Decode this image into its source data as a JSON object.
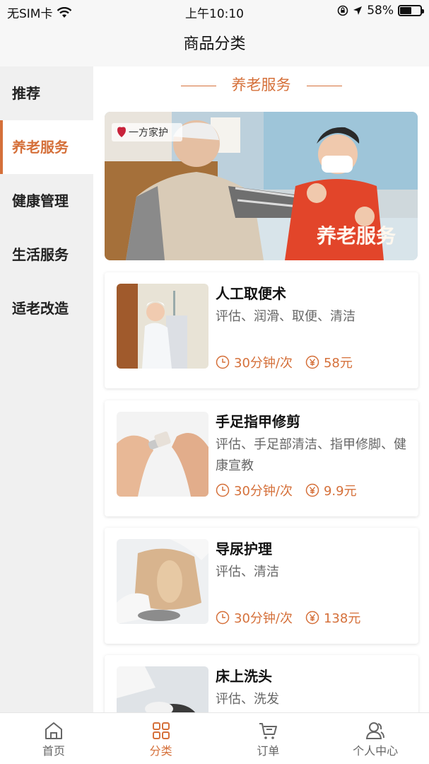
{
  "status_bar": {
    "carrier": "无SIM卡",
    "time": "上午10:10",
    "battery": "58%",
    "battery_level": 0.58
  },
  "header": {
    "title": "商品分类"
  },
  "sidebar": {
    "items": [
      {
        "label": "推荐"
      },
      {
        "label": "养老服务"
      },
      {
        "label": "健康管理"
      },
      {
        "label": "生活服务"
      },
      {
        "label": "适老改造"
      }
    ],
    "active_index": 1
  },
  "main": {
    "section_title": "养老服务",
    "banner": {
      "logo_text": "一方家护",
      "overlay_text": "养老服务"
    },
    "services": [
      {
        "name": "人工取便术",
        "desc": "评估、润滑、取便、清洁",
        "duration": "30分钟/次",
        "price": "58元"
      },
      {
        "name": "手足指甲修剪",
        "desc": "评估、手足部清洁、指甲修脚、健康宣教",
        "duration": "30分钟/次",
        "price": "9.9元"
      },
      {
        "name": "导尿护理",
        "desc": "评估、清洁",
        "duration": "30分钟/次",
        "price": "138元"
      },
      {
        "name": "床上洗头",
        "desc": "评估、洗发",
        "duration": "",
        "price": ""
      }
    ]
  },
  "tabbar": {
    "items": [
      {
        "label": "首页",
        "icon": "home-icon"
      },
      {
        "label": "分类",
        "icon": "grid-icon"
      },
      {
        "label": "订单",
        "icon": "cart-icon"
      },
      {
        "label": "个人中心",
        "icon": "user-icon"
      }
    ],
    "active_index": 1
  },
  "colors": {
    "accent": "#d5703a"
  }
}
